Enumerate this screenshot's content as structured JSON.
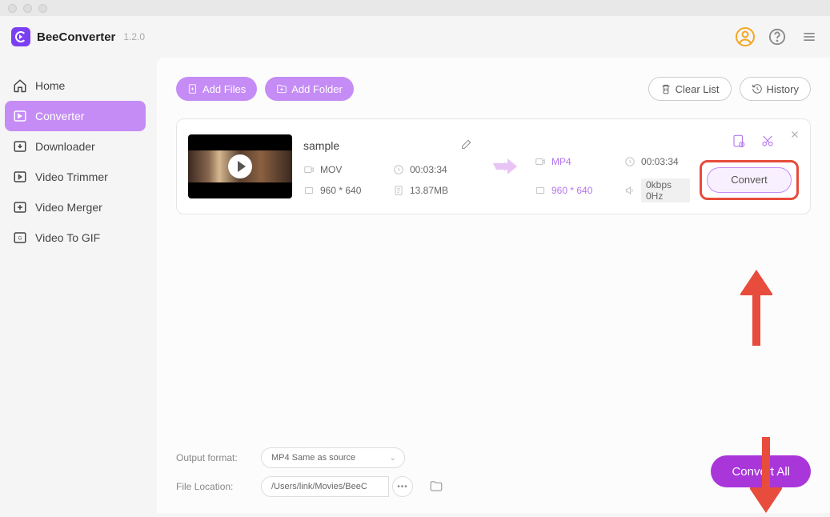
{
  "app": {
    "name": "BeeConverter",
    "version": "1.2.0"
  },
  "sidebar": {
    "items": [
      {
        "label": "Home"
      },
      {
        "label": "Converter"
      },
      {
        "label": "Downloader"
      },
      {
        "label": "Video Trimmer"
      },
      {
        "label": "Video Merger"
      },
      {
        "label": "Video To GIF"
      }
    ]
  },
  "toolbar": {
    "add_files": "Add Files",
    "add_folder": "Add Folder",
    "clear_list": "Clear List",
    "history": "History"
  },
  "file": {
    "name": "sample",
    "src": {
      "format": "MOV",
      "duration": "00:03:34",
      "resolution": "960 * 640",
      "size": "13.87MB"
    },
    "dst": {
      "format": "MP4",
      "duration": "00:03:34",
      "resolution": "960 * 640",
      "audio": "0kbps 0Hz"
    },
    "convert_label": "Convert"
  },
  "bottom": {
    "output_format_label": "Output format:",
    "output_format_value": "MP4 Same as source",
    "file_location_label": "File Location:",
    "file_location_value": "/Users/link/Movies/BeeC"
  },
  "convert_all": "Convert All"
}
